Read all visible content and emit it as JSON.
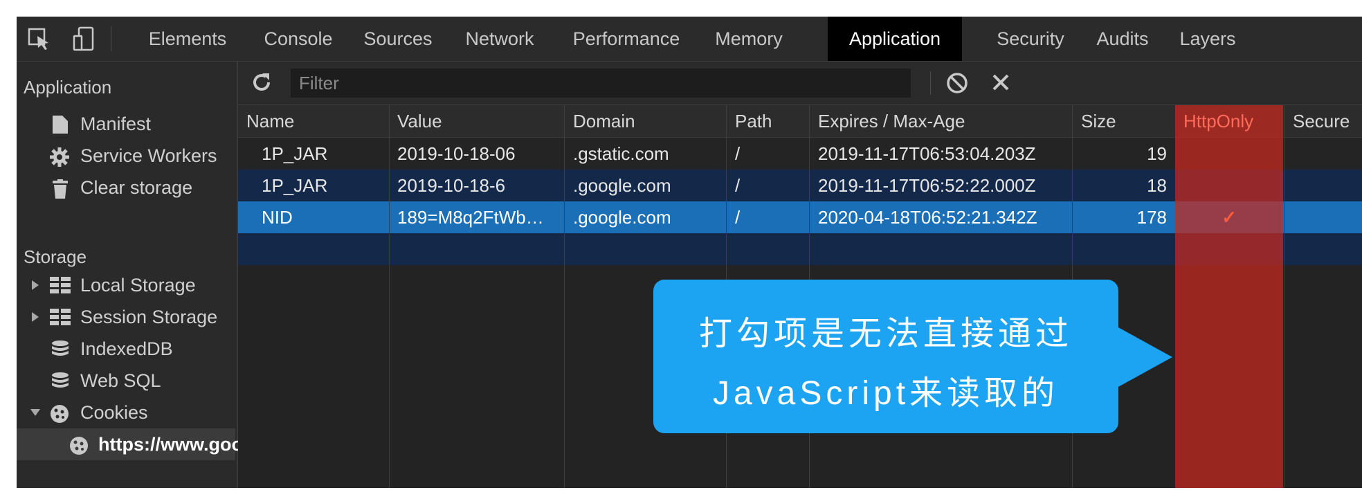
{
  "tabs": [
    "Elements",
    "Console",
    "Sources",
    "Network",
    "Performance",
    "Memory",
    "Application",
    "Security",
    "Audits",
    "Layers"
  ],
  "active_tab": "Application",
  "sidebar": {
    "application_heading": "Application",
    "application_items": [
      "Manifest",
      "Service Workers",
      "Clear storage"
    ],
    "storage_heading": "Storage",
    "storage_items": [
      "Local Storage",
      "Session Storage",
      "IndexedDB",
      "Web SQL",
      "Cookies"
    ],
    "cookie_site": "https://www.goo"
  },
  "toolbar": {
    "filter_placeholder": "Filter"
  },
  "table": {
    "columns": [
      "Name",
      "Value",
      "Domain",
      "Path",
      "Expires / Max-Age",
      "Size",
      "HttpOnly",
      "Secure"
    ],
    "rows": [
      {
        "name": "1P_JAR",
        "value": "2019-10-18-06",
        "domain": ".gstatic.com",
        "path": "/",
        "expires": "2019-11-17T06:53:04.203Z",
        "size": "19",
        "httponly": ""
      },
      {
        "name": "1P_JAR",
        "value": "2019-10-18-6",
        "domain": ".google.com",
        "path": "/",
        "expires": "2019-11-17T06:52:22.000Z",
        "size": "18",
        "httponly": ""
      },
      {
        "name": "NID",
        "value": "189=M8q2FtWb…",
        "domain": ".google.com",
        "path": "/",
        "expires": "2020-04-18T06:52:21.342Z",
        "size": "178",
        "httponly": "✓"
      }
    ]
  },
  "callout": {
    "line1": "打勾项是无法直接通过",
    "line2": "JavaScript来读取的"
  },
  "colors": {
    "highlight": "#c8281e",
    "callout": "#1ca3f2",
    "selected_row": "#1a6fb6"
  }
}
